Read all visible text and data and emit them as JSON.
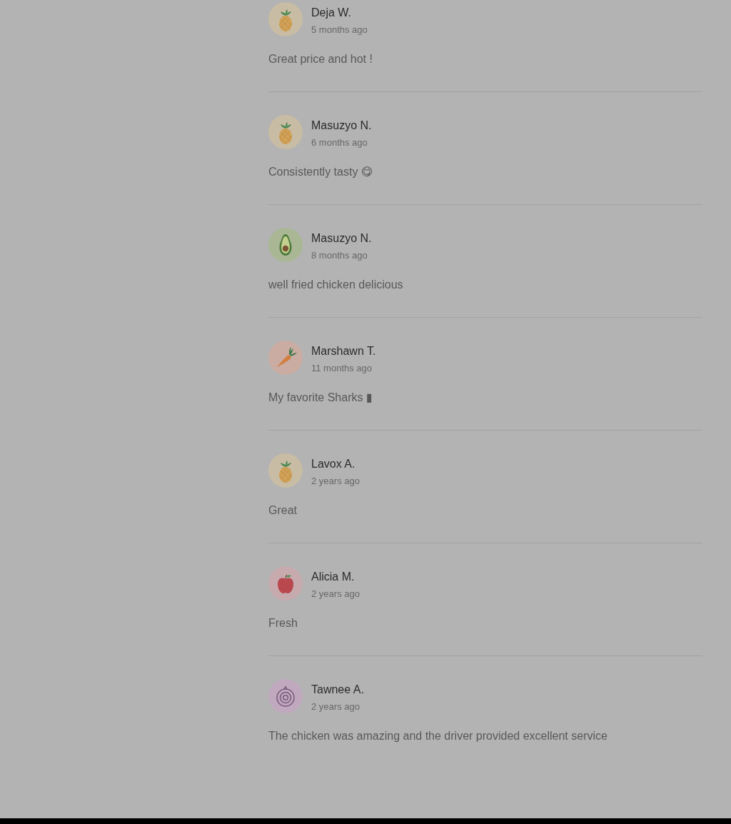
{
  "reviews": [
    {
      "name": "Deja W.",
      "time": "5 months ago",
      "text": "Great price and hot !",
      "avatar": {
        "kind": "pineapple"
      }
    },
    {
      "name": "Masuzyo N.",
      "time": "6 months ago",
      "text": "Consistently tasty 😋",
      "avatar": {
        "kind": "pineapple"
      }
    },
    {
      "name": "Masuzyo N.",
      "time": "8 months ago",
      "text": "well fried chicken delicious",
      "avatar": {
        "kind": "avocado"
      }
    },
    {
      "name": "Marshawn T.",
      "time": "11 months ago",
      "text": "My favorite Sharks ▮",
      "avatar": {
        "kind": "carrot"
      }
    },
    {
      "name": "Lavox A.",
      "time": "2 years ago",
      "text": "Great",
      "avatar": {
        "kind": "pineapple"
      }
    },
    {
      "name": "Alicia M.",
      "time": "2 years ago",
      "text": "Fresh",
      "avatar": {
        "kind": "apple"
      }
    },
    {
      "name": "Tawnee A.",
      "time": "2 years ago",
      "text": "The chicken was amazing and the driver provided excellent service",
      "avatar": {
        "kind": "onion"
      }
    }
  ]
}
